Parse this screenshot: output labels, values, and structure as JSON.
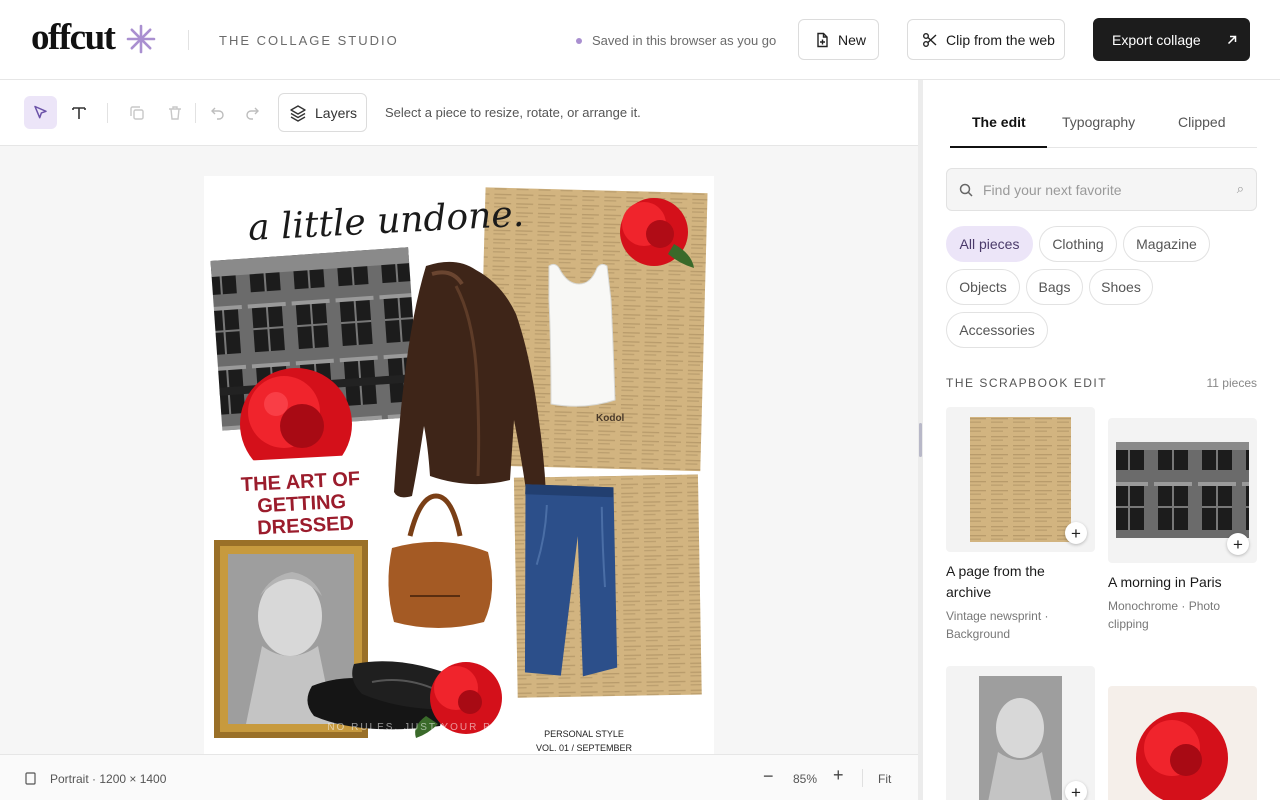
{
  "header": {
    "logo": "offcut",
    "studio": "THE COLLAGE STUDIO",
    "saved_status": "Saved in this browser as you go",
    "new_label": "New",
    "clip_label": "Clip from the web",
    "export_label": "Export collage"
  },
  "toolbar": {
    "layers_label": "Layers",
    "hint": "Select a piece to resize, rotate, or arrange it."
  },
  "collage": {
    "headline": "a little undone.",
    "art_title": "THE ART OF GETTING DRESSED",
    "footer_tagline": "NO RULES. JUST YOUR POINT OF VIEW.",
    "issue_line1": "PERSONAL STYLE",
    "issue_line2": "VOL. 01 / SEPTEMBER",
    "newsprint_brand": "Kodol"
  },
  "statusbar": {
    "format": "Portrait · 1200 × 1400",
    "zoom": "85%",
    "fit_label": "Fit"
  },
  "panel": {
    "tabs": [
      {
        "label": "The edit"
      },
      {
        "label": "Typography"
      },
      {
        "label": "Clipped"
      }
    ],
    "search_placeholder": "Find your next favorite",
    "chips": [
      {
        "label": "All pieces"
      },
      {
        "label": "Clothing"
      },
      {
        "label": "Magazine"
      },
      {
        "label": "Objects"
      },
      {
        "label": "Bags"
      },
      {
        "label": "Shoes"
      },
      {
        "label": "Accessories"
      }
    ],
    "section_title": "THE SCRAPBOOK EDIT",
    "section_count": "11 pieces",
    "cards": [
      {
        "title": "A page from the archive",
        "sub": "Vintage newsprint · Background"
      },
      {
        "title": "A morning in Paris",
        "sub": "Monochrome · Photo clipping"
      },
      {
        "title": "",
        "sub": ""
      },
      {
        "title": "",
        "sub": ""
      }
    ]
  },
  "colors": {
    "accent": "#a98fd0",
    "accent_bg": "#ece5f8",
    "dark_button": "#1c1c1c",
    "rose_red": "#e0141e",
    "title_red": "#9b1c2c"
  }
}
